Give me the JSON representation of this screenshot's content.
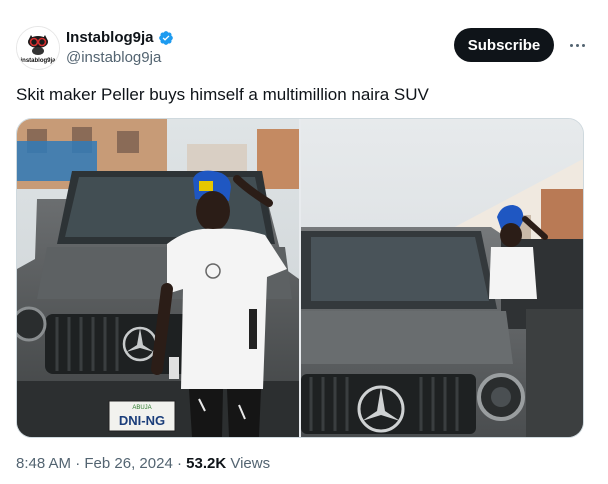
{
  "author": {
    "display_name": "Instablog9ja",
    "handle": "@instablog9ja",
    "verified": true,
    "avatar_icon": "instablog9ja-logo-icon",
    "avatar_text": "instablog9ja"
  },
  "actions": {
    "subscribe_label": "Subscribe",
    "more_icon": "more-horizontal-icon"
  },
  "tweet": {
    "text": "Skit maker Peller buys himself a multimillion naira SUV"
  },
  "media": {
    "photos": [
      {
        "description": "person-standing-in-front-of-suv",
        "plate_text": "DNI-NG",
        "plate_top": "ABUJA"
      },
      {
        "description": "suv-front-with-person-in-door"
      }
    ]
  },
  "meta": {
    "time": "8:48 AM",
    "separator": "·",
    "date": "Feb 26, 2024",
    "views_count": "53.2K",
    "views_label": "Views"
  },
  "colors": {
    "accent": "#1d9bf0",
    "text": "#0f1419",
    "muted": "#536471",
    "button_bg": "#0f1419"
  }
}
